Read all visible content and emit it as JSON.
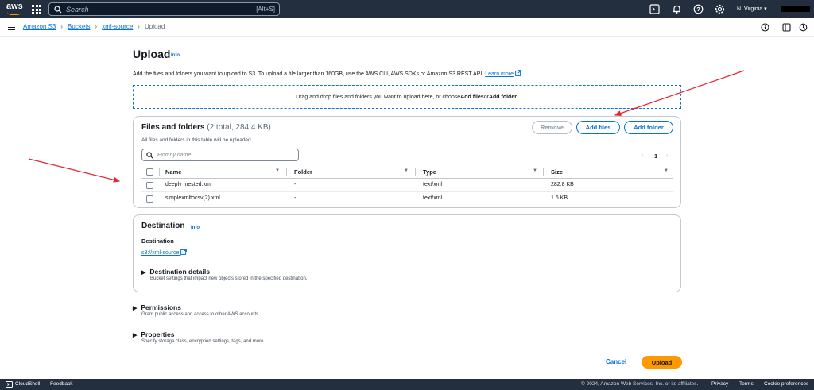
{
  "topnav": {
    "logo_text": "aws",
    "search_placeholder": "Search",
    "search_shortcut": "[Alt+S]",
    "region": "N. Virginia ▾",
    "icons": [
      "cloudshell-icon",
      "bell-icon",
      "help-icon",
      "settings-icon"
    ]
  },
  "breadcrumbs": {
    "items": [
      "Amazon S3",
      "Buckets",
      "xml-source"
    ],
    "current": "Upload"
  },
  "page": {
    "title": "Upload",
    "info": "Info",
    "intro": "Add the files and folders you want to upload to S3. To upload a file larger than 160GB, use the AWS CLI, AWS SDKs or Amazon S3 REST API.",
    "learn_more": "Learn more",
    "dropzone_prefix": "Drag and drop files and folders you want to upload here, or choose ",
    "dropzone_files": "Add files",
    "dropzone_or": " or ",
    "dropzone_folder": "Add folder",
    "dropzone_end": "."
  },
  "files_panel": {
    "title": "Files and folders",
    "count": "(2 total, 284.4 KB)",
    "subtitle": "All files and folders in this table will be uploaded.",
    "remove_label": "Remove",
    "add_files_label": "Add files",
    "add_folder_label": "Add folder",
    "filter_placeholder": "Find by name",
    "page_number": "1",
    "columns": [
      "Name",
      "Folder",
      "Type",
      "Size"
    ],
    "rows": [
      {
        "name": "deeply_nested.xml",
        "folder": "-",
        "type": "text/xml",
        "size": "282.8 KB"
      },
      {
        "name": "simplexmltocsv(2).xml",
        "folder": "-",
        "type": "text/xml",
        "size": "1.6 KB"
      }
    ]
  },
  "destination": {
    "title": "Destination",
    "info": "Info",
    "label": "Destination",
    "uri": "s3://xml-source",
    "details_title": "Destination details",
    "details_sub": "Bucket settings that impact new objects stored in the specified destination."
  },
  "permissions": {
    "title": "Permissions",
    "sub": "Grant public access and access to other AWS accounts."
  },
  "properties": {
    "title": "Properties",
    "sub": "Specify storage class, encryption settings, tags, and more."
  },
  "actions": {
    "cancel": "Cancel",
    "upload": "Upload"
  },
  "footer": {
    "cloudshell": "CloudShell",
    "feedback": "Feedback",
    "copyright": "© 2024, Amazon Web Services, Inc. or its affiliates.",
    "privacy": "Privacy",
    "terms": "Terms",
    "cookies": "Cookie preferences"
  },
  "colors": {
    "nav_bg": "#232f3e",
    "link": "#0972d3",
    "primary": "#ff9900",
    "annotation_arrow": "#e8232a"
  }
}
